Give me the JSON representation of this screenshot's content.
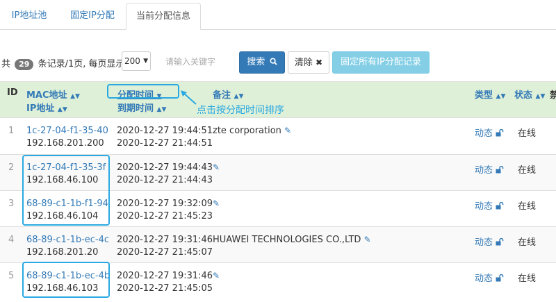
{
  "tabs": [
    {
      "label": "IP地址池"
    },
    {
      "label": "固定IP分配"
    },
    {
      "label": "当前分配信息"
    }
  ],
  "toolbar": {
    "total_prefix": "共",
    "total_count": "29",
    "total_suffix": "条记录/1页, 每页显示",
    "page_size": "200",
    "search_placeholder": "请输入关键字",
    "search_label": "搜索",
    "clear_label": "清除",
    "fix_all_label": "固定所有IP分配记录"
  },
  "table": {
    "headers": {
      "id": "ID",
      "mac": "MAC地址",
      "ip": "IP地址",
      "assign_time": "分配时间",
      "expire_time": "到期时间",
      "note": "备注",
      "type": "类型",
      "status": "状态",
      "overflow": "禁"
    },
    "rows": [
      {
        "id": "1",
        "mac": "1c-27-04-f1-35-40",
        "ip": "192.168.201.200",
        "assign": "2020-12-27 19:44:51",
        "expire": "2020-12-27 21:44:51",
        "note": "zte corporation",
        "type": "动态",
        "status": "在线"
      },
      {
        "id": "2",
        "mac": "1c-27-04-f1-35-3f",
        "ip": "192.168.46.100",
        "assign": "2020-12-27 19:44:43",
        "expire": "2020-12-27 21:44:43",
        "note": "",
        "type": "动态",
        "status": "在线"
      },
      {
        "id": "3",
        "mac": "68-89-c1-1b-f1-94",
        "ip": "192.168.46.104",
        "assign": "2020-12-27 19:32:09",
        "expire": "2020-12-27 21:45:23",
        "note": "",
        "type": "动态",
        "status": "在线"
      },
      {
        "id": "4",
        "mac": "68-89-c1-1b-ec-4c",
        "ip": "192.168.201.20",
        "assign": "2020-12-27 19:31:46",
        "expire": "2020-12-27 21:45:07",
        "note": "HUAWEI TECHNOLOGIES CO.,LTD",
        "type": "动态",
        "status": "在线"
      },
      {
        "id": "5",
        "mac": "68-89-c1-1b-ec-4b",
        "ip": "192.168.46.103",
        "assign": "2020-12-27 19:31:46",
        "expire": "2020-12-27 21:45:05",
        "note": "",
        "type": "动态",
        "status": "在线"
      }
    ]
  },
  "annotation": {
    "text": "点击按分配时间排序"
  },
  "colors": {
    "accent": "#337ab7",
    "highlight": "#29a9e1",
    "header_bg": "#dff0d8"
  }
}
